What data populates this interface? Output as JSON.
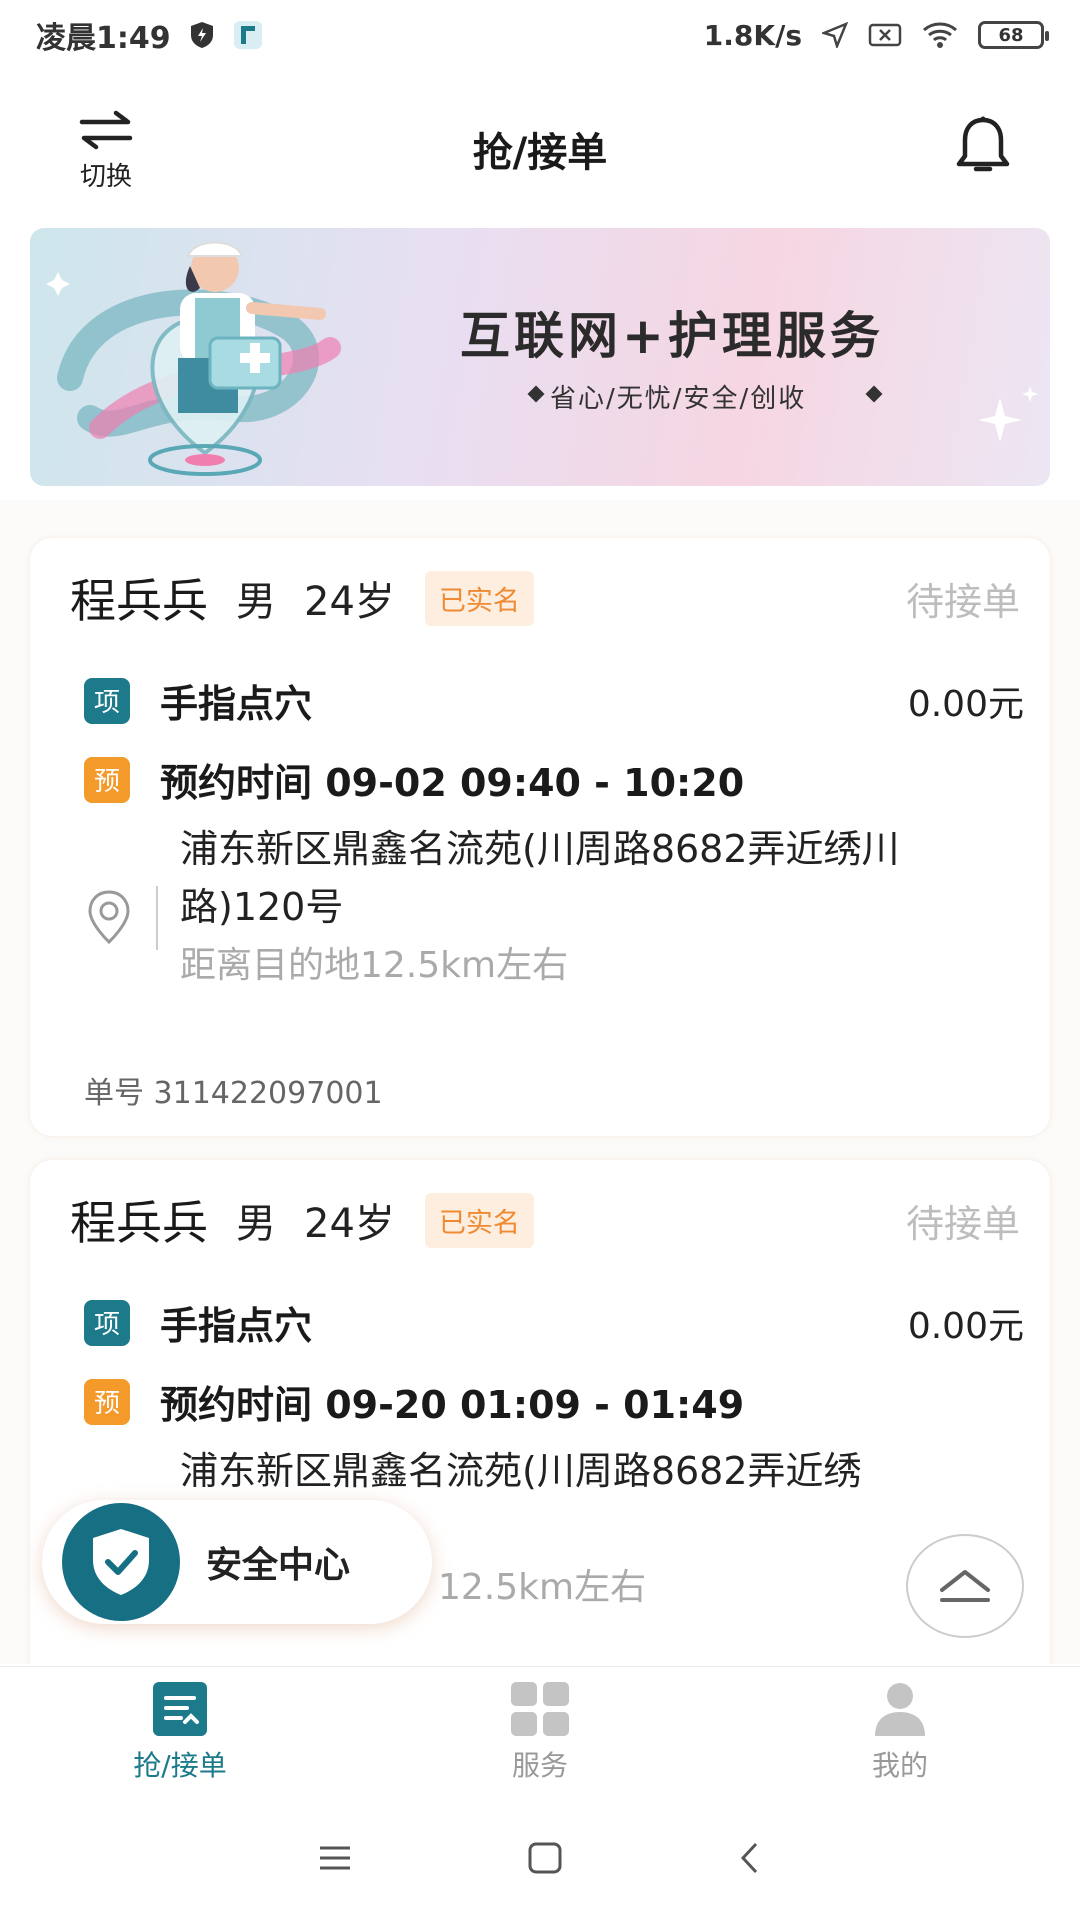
{
  "status_bar": {
    "time": "凌晨1:49",
    "net_speed": "1.8K/s",
    "battery": "68"
  },
  "header": {
    "switch_label": "切换",
    "title": "抢/接单"
  },
  "banner": {
    "title": "互联网+护理服务",
    "subtitle": "省心/无忧/安全/创收"
  },
  "orders": [
    {
      "name": "程兵兵",
      "gender": "男",
      "age": "24岁",
      "verified": "已实名",
      "state": "待接单",
      "item_tag": "项",
      "item": "手指点穴",
      "price": "0.00元",
      "book_tag": "预",
      "time": "预约时间  09-02  09:40 - 10:20",
      "address": "浦东新区鼎鑫名流苑(川周路8682弄近绣川路)120号",
      "distance": "距离目的地12.5km左右",
      "order_no": "单号 311422097001"
    },
    {
      "name": "程兵兵",
      "gender": "男",
      "age": "24岁",
      "verified": "已实名",
      "state": "待接单",
      "item_tag": "项",
      "item": "手指点穴",
      "price": "0.00元",
      "book_tag": "预",
      "time": "预约时间  09-20  01:09 - 01:49",
      "address": "浦东新区鼎鑫名流苑(川周路8682弄近绣",
      "distance": "12.5km左右"
    }
  ],
  "safety_center": "安全中心",
  "tabbar": {
    "items": [
      {
        "label": "抢/接单"
      },
      {
        "label": "服务"
      },
      {
        "label": "我的"
      }
    ]
  },
  "colors": {
    "accent": "#1c7a8a",
    "tag_orange": "#f39a2b",
    "verified_text": "#f08a32",
    "inactive": "#999999"
  }
}
